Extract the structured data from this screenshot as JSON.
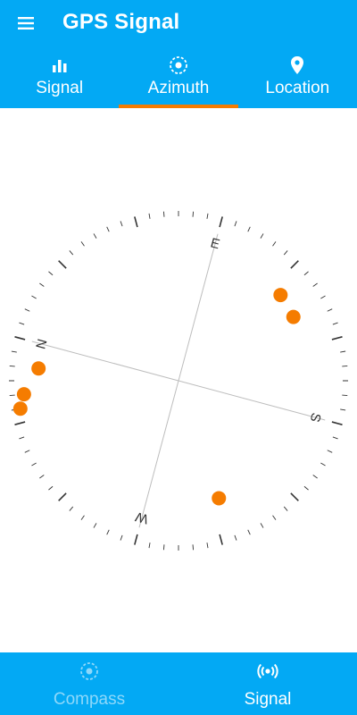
{
  "app": {
    "title": "GPS Signal",
    "menu_icon": "hamburger-menu-icon"
  },
  "tabs": [
    {
      "label": "Signal",
      "icon": "bar-chart-icon",
      "active": false
    },
    {
      "label": "Azimuth",
      "icon": "radio-target-icon",
      "active": true
    },
    {
      "label": "Location",
      "icon": "location-pin-icon",
      "active": false
    }
  ],
  "compass": {
    "cardinals": {
      "north": "N",
      "east": "E",
      "south": "S",
      "west": "W"
    },
    "rotation_deg": -75,
    "satellites": [
      {
        "azimuth_deg": 335,
        "elevation_deg": 2
      },
      {
        "azimuth_deg": 340,
        "elevation_deg": 5
      },
      {
        "azimuth_deg": 350,
        "elevation_deg": 13
      },
      {
        "azimuth_deg": 125,
        "elevation_deg": 17
      },
      {
        "azimuth_deg": 136,
        "elevation_deg": 18
      },
      {
        "azimuth_deg": 236,
        "elevation_deg": 22
      }
    ]
  },
  "bottom_nav": [
    {
      "label": "Compass",
      "icon": "compass-target-icon",
      "active": false
    },
    {
      "label": "Signal",
      "icon": "broadcast-signal-icon",
      "active": true
    }
  ],
  "colors": {
    "primary": "#03A9F4",
    "accent": "#F57C00",
    "inactive_nav": "#8ED8FA",
    "tick": "#333333",
    "crosshair": "#BDBDBD"
  }
}
